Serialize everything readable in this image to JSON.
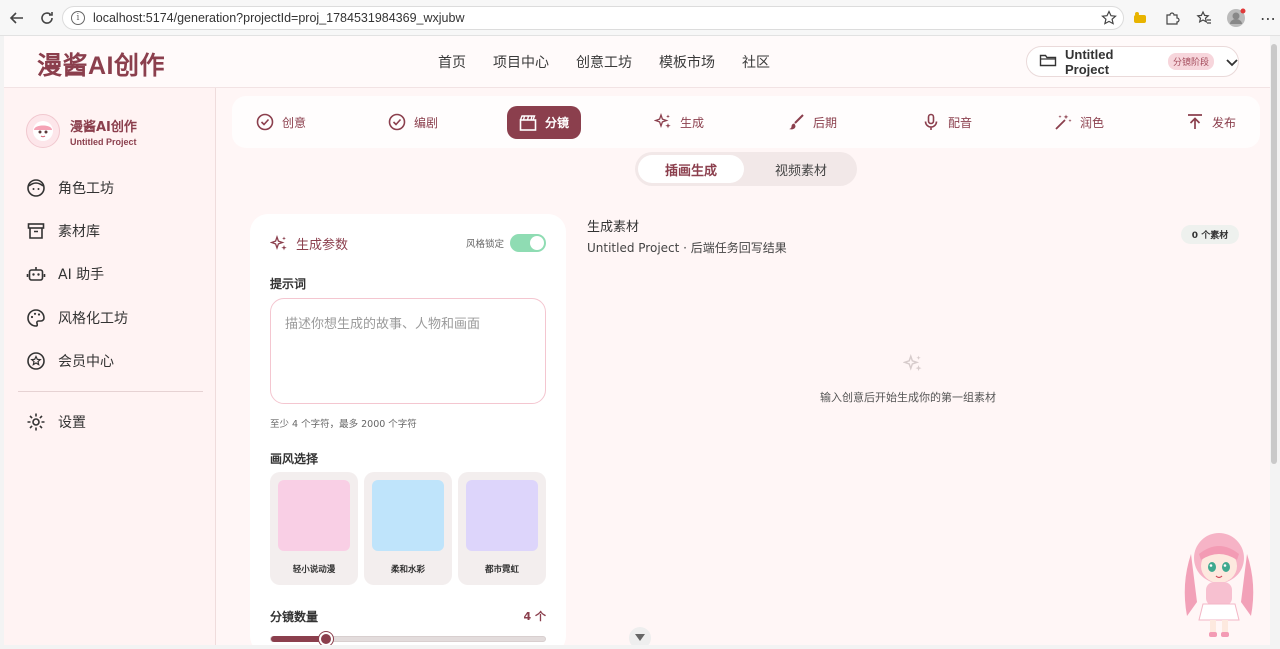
{
  "browser": {
    "url": "localhost:5174/generation?projectId=proj_1784531984369_wxjubw"
  },
  "app": {
    "brand": "漫酱AI创作",
    "menu": [
      "首页",
      "项目中心",
      "创意工坊",
      "模板市场",
      "社区"
    ],
    "project_name": "Untitled Project",
    "project_badge": "分镜阶段"
  },
  "sidebar": {
    "brand_title": "漫酱AI创作",
    "brand_sub": "Untitled Project",
    "items": [
      {
        "label": "角色工坊",
        "icon": "face-icon"
      },
      {
        "label": "素材库",
        "icon": "archive-icon"
      },
      {
        "label": "AI 助手",
        "icon": "robot-icon"
      },
      {
        "label": "风格化工坊",
        "icon": "palette-icon"
      },
      {
        "label": "会员中心",
        "icon": "star-circle-icon"
      }
    ],
    "settings": "设置"
  },
  "steps": [
    {
      "label": "创意",
      "icon": "check-circle-icon"
    },
    {
      "label": "编剧",
      "icon": "check-circle-icon"
    },
    {
      "label": "分镜",
      "icon": "clapperboard-icon",
      "active": true
    },
    {
      "label": "生成",
      "icon": "sparkles-icon"
    },
    {
      "label": "后期",
      "icon": "brush-icon"
    },
    {
      "label": "配音",
      "icon": "mic-icon"
    },
    {
      "label": "润色",
      "icon": "magic-wand-icon"
    },
    {
      "label": "发布",
      "icon": "upload-icon"
    }
  ],
  "subtabs": [
    "插画生成",
    "视频素材"
  ],
  "panel": {
    "title": "生成参数",
    "style_lock_label": "风格锁定",
    "style_lock_on": true,
    "prompt_label": "提示词",
    "prompt_placeholder": "描述你想生成的故事、人物和画面",
    "prompt_hint": "至少 4 个字符，最多 2000 个字符",
    "style_label": "画风选择",
    "styles": [
      {
        "name": "轻小说动漫",
        "color": "#f9cfe5"
      },
      {
        "name": "柔和水彩",
        "color": "#bfe4fb"
      },
      {
        "name": "都市霓虹",
        "color": "#ddd5fb"
      }
    ],
    "count_label": "分镜数量",
    "count_value": "4 个",
    "slider_fraction": 0.2
  },
  "materials": {
    "title": "生成素材",
    "subtitle": "Untitled Project · 后端任务回写结果",
    "count": "0 个素材",
    "empty_text": "输入创意后开始生成你的第一组素材"
  },
  "colors": {
    "accent": "#8b3f4d",
    "toggle_on": "#8fdcb3"
  }
}
